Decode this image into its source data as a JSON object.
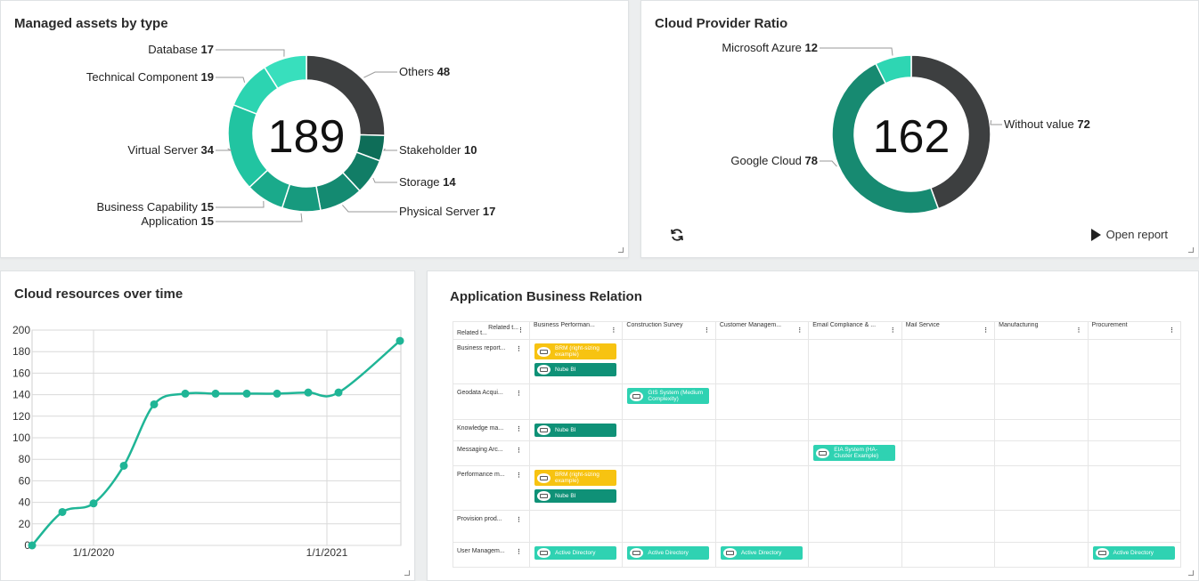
{
  "card1": {
    "title": "Managed assets by type",
    "total": "189",
    "segments": [
      {
        "label": "Others",
        "value": 48,
        "color": "#3d3f40"
      },
      {
        "label": "Stakeholder",
        "value": 10,
        "color": "#0e6d58"
      },
      {
        "label": "Storage",
        "value": 14,
        "color": "#117d66"
      },
      {
        "label": "Physical Server",
        "value": 17,
        "color": "#148a71"
      },
      {
        "label": "Application",
        "value": 15,
        "color": "#179a7e"
      },
      {
        "label": "Business Capability",
        "value": 15,
        "color": "#1aaa8b"
      },
      {
        "label": "Virtual Server",
        "value": 34,
        "color": "#21c4a1"
      },
      {
        "label": "Technical Component",
        "value": 19,
        "color": "#2cd4b1"
      },
      {
        "label": "Database",
        "value": 17,
        "color": "#38dfbd"
      }
    ]
  },
  "card2": {
    "title": "Cloud Provider Ratio",
    "total": "162",
    "segments": [
      {
        "label": "Without value",
        "value": 72,
        "color": "#3d3f40"
      },
      {
        "label": "Google Cloud",
        "value": 78,
        "color": "#178a71"
      },
      {
        "label": "Microsoft Azure",
        "value": 12,
        "color": "#2ed6b3"
      }
    ],
    "open_report": "Open report",
    "icons": {
      "refresh": "refresh-icon",
      "play": "play-icon"
    }
  },
  "card3": {
    "title": "Cloud resources over time",
    "chart_data": {
      "type": "line",
      "title": "Cloud resources over time",
      "xlabel": "",
      "ylabel": "",
      "ylim": [
        0,
        200
      ],
      "yticks": [
        0,
        20,
        40,
        60,
        80,
        100,
        120,
        140,
        160,
        180,
        200
      ],
      "xtick_labels": [
        "1/1/2020",
        "1/1/2021"
      ],
      "series": [
        {
          "color": "#1fb596",
          "values": [
            0,
            31,
            39,
            74,
            131,
            141,
            141,
            141,
            141,
            142,
            142,
            190
          ]
        }
      ]
    }
  },
  "card4": {
    "title": "Application Business Relation",
    "corner_top": "Related t...",
    "corner_left": "Related t...",
    "columns": [
      "Business Performan...",
      "Construction Survey",
      "Customer Managem...",
      "Email Compliance & ...",
      "Mail Service",
      "Manufacturing",
      "Procurement"
    ],
    "rows": [
      {
        "label": "Business report...",
        "cells": [
          [
            {
              "t": "BRM (right-sizing example)",
              "c": "yellow"
            },
            {
              "t": "Nube BI",
              "c": "dark"
            }
          ],
          [],
          [],
          [],
          [],
          [],
          []
        ]
      },
      {
        "label": "Geodata Acqui...",
        "cells": [
          [],
          [
            {
              "t": "GIS System (Medium Complexity)",
              "c": "teal"
            }
          ],
          [],
          [],
          [],
          [],
          []
        ]
      },
      {
        "label": "Knowledge ma...",
        "cells": [
          [
            {
              "t": "Nube BI",
              "c": "dark"
            }
          ],
          [],
          [],
          [],
          [],
          [],
          []
        ]
      },
      {
        "label": "Messaging Arc...",
        "cells": [
          [],
          [],
          [],
          [
            {
              "t": "EIA System (HA-Cluster Example)",
              "c": "teal"
            }
          ],
          [],
          [],
          []
        ]
      },
      {
        "label": "Performance m...",
        "cells": [
          [
            {
              "t": "BRM (right-sizing example)",
              "c": "yellow"
            },
            {
              "t": "Nube BI",
              "c": "dark"
            }
          ],
          [],
          [],
          [],
          [],
          [],
          []
        ]
      },
      {
        "label": "Provision prod...",
        "cells": [
          [],
          [],
          [],
          [],
          [],
          [],
          []
        ]
      },
      {
        "label": "User Managem...",
        "cells": [
          [
            {
              "t": "Active Directory",
              "c": "teal"
            }
          ],
          [
            {
              "t": "Active Directory",
              "c": "teal"
            }
          ],
          [
            {
              "t": "Active Directory",
              "c": "teal"
            }
          ],
          [],
          [],
          [],
          [
            {
              "t": "Active Directory",
              "c": "teal"
            }
          ]
        ]
      }
    ]
  }
}
